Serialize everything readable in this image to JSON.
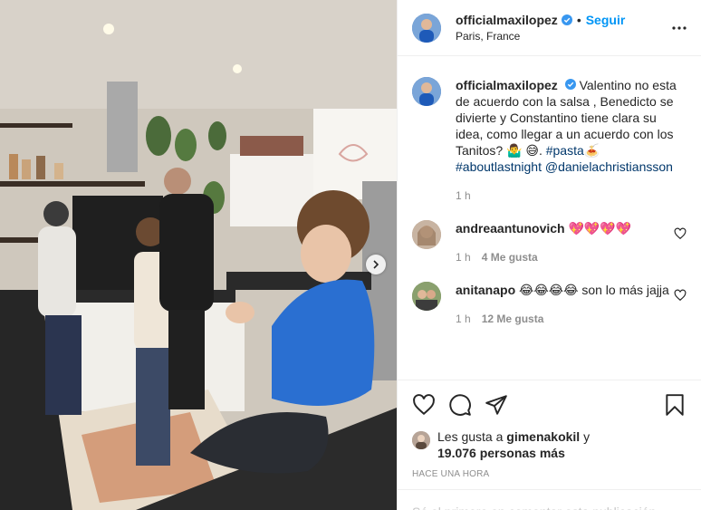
{
  "post": {
    "username": "officialmaxilopez",
    "follow_label": "Seguir",
    "dot": "•",
    "location": "Paris, France",
    "more_label": "More options"
  },
  "caption": {
    "username": "officialmaxilopez",
    "text": "Valentino no esta de acuerdo con la salsa , Benedicto se divierte y Constantino tiene clara su idea, como llegar a un acuerdo con los Tanitos? 🤷‍♂️ 😅.",
    "hashtag1": "#pasta",
    "emoji_after_hashtag": "🍝",
    "hashtag2": "#aboutlastnight",
    "mention": "@danielachristiansson",
    "time": "1 h"
  },
  "comments": [
    {
      "username": "andreaantunovich",
      "text": "💖💖💖💖",
      "time": "1 h",
      "likes": "4 Me gusta"
    },
    {
      "username": "anitanapo",
      "text": "😂😂😂😂 son lo más jajja",
      "time": "1 h",
      "likes": "12 Me gusta"
    }
  ],
  "likes": {
    "prefix": "Les gusta a",
    "user": "gimenakokil",
    "joiner": "y",
    "count": "19.076 personas más"
  },
  "timestamp": "Hace una hora",
  "add_comment_placeholder": "Sé el primero en comentar esta publicación",
  "icons": {
    "like": "heart-icon",
    "comment": "comment-icon",
    "share": "share-icon",
    "save": "bookmark-icon",
    "more": "ellipsis-icon",
    "carousel_next": "chevron-right-icon"
  },
  "colors": {
    "accent": "#0095f6",
    "muted": "#8e8e8e",
    "link": "#00376b",
    "verified": "#3897f0"
  }
}
